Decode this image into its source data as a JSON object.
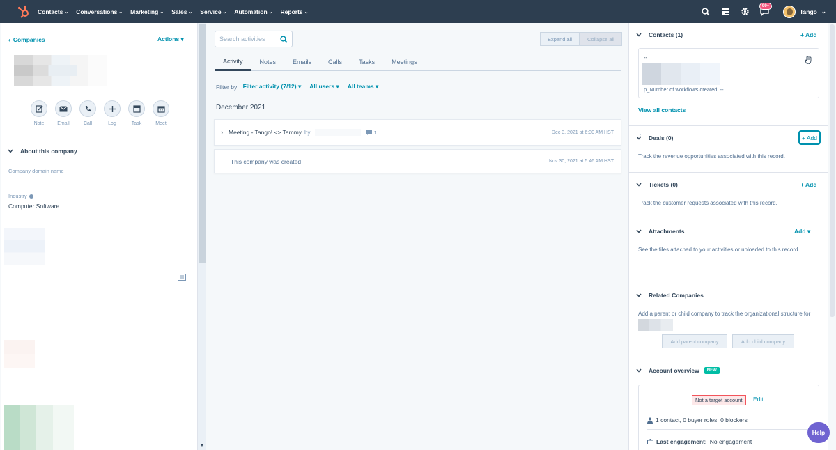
{
  "nav": {
    "items": [
      "Contacts",
      "Conversations",
      "Marketing",
      "Sales",
      "Service",
      "Automation",
      "Reports"
    ],
    "notifications_badge": "99+",
    "user_name": "Tango"
  },
  "left": {
    "back_label": "Companies",
    "actions_label": "Actions",
    "quick_actions": [
      "Note",
      "Email",
      "Call",
      "Log",
      "Task",
      "Meet"
    ],
    "about_title": "About this company",
    "domain_label": "Company domain name",
    "industry_label": "Industry",
    "industry_value": "Computer Software"
  },
  "middle": {
    "search_placeholder": "Search activities",
    "expand_all": "Expand all",
    "collapse_all": "Collapse all",
    "tabs": [
      "Activity",
      "Notes",
      "Emails",
      "Calls",
      "Tasks",
      "Meetings"
    ],
    "filter_by": "Filter by:",
    "filter_activity": "Filter activity (7/12)",
    "all_users": "All users",
    "all_teams": "All teams",
    "month": "December 2021",
    "meeting_title": "Meeting - Tango! <> Tammy",
    "meeting_by": "by",
    "meeting_comments": "1",
    "meeting_date": "Dec 3, 2021 at 6:30 AM HST",
    "created_text": "This company was created",
    "created_date": "Nov 30, 2021 at 5:46 AM HST"
  },
  "right": {
    "contacts_title": "Contacts (1)",
    "add_label": "+ Add",
    "contact_dash": "--",
    "contact_workflows": "p_Number of workflows created: --",
    "view_all_contacts": "View all contacts",
    "deals_title": "Deals (0)",
    "deals_text": "Track the revenue opportunities associated with this record.",
    "tickets_title": "Tickets (0)",
    "tickets_text": "Track the customer requests associated with this record.",
    "attachments_title": "Attachments",
    "attachments_add": "Add",
    "attachments_text": "See the files attached to your activities or uploaded to this record.",
    "related_title": "Related Companies",
    "related_text": "Add a parent or child company to track the organizational structure for",
    "add_parent": "Add parent company",
    "add_child": "Add child company",
    "account_title": "Account overview",
    "new_badge": "NEW",
    "target_label": "Not a target account",
    "edit_label": "Edit",
    "contacts_roles": "1 contact, 0 buyer roles, 0 blockers",
    "last_engagement_label": "Last engagement:",
    "last_engagement_value": "No engagement"
  },
  "help_label": "Help",
  "colors": {
    "nav_bg": "#2d3e50",
    "accent": "#0091ae",
    "brand_orange": "#ff7a59",
    "new_badge": "#00bda5",
    "help_bg": "#6f63d1"
  }
}
